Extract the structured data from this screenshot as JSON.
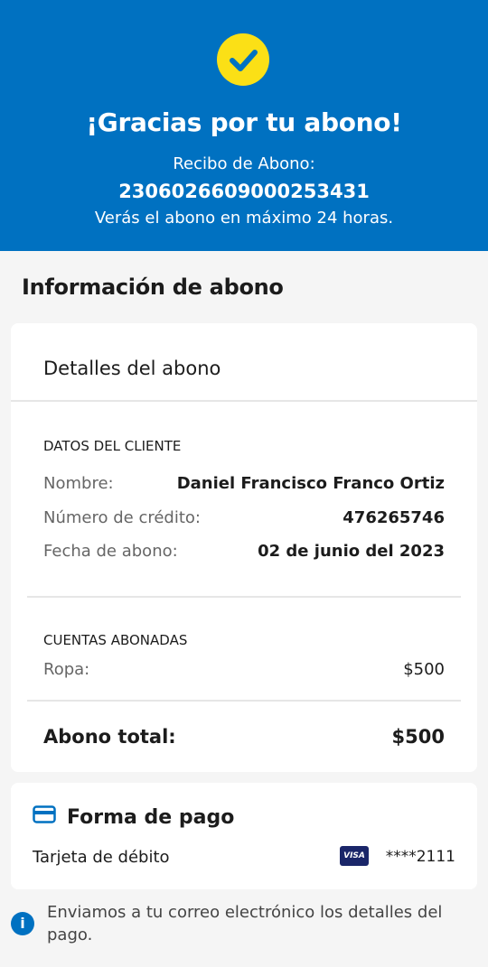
{
  "header": {
    "title": "¡Gracias por tu abono!",
    "receipt_label": "Recibo de Abono:",
    "receipt_number": "2306026609000253431",
    "note": "Verás el abono en máximo 24 horas.",
    "icon": "check-circle-icon",
    "bg_color": "#0071c1",
    "icon_color": "#fbe016"
  },
  "section_title": "Información de abono",
  "details": {
    "title": "Detalles del abono",
    "client": {
      "heading": "DATOS DEL CLIENTE",
      "rows": [
        {
          "label": "Nombre:",
          "value": "Daniel Francisco Franco Ortiz"
        },
        {
          "label": "Número de crédito:",
          "value": "476265746"
        },
        {
          "label": "Fecha de abono:",
          "value": "02 de junio del 2023"
        }
      ]
    },
    "accounts": {
      "heading": "CUENTAS ABONADAS",
      "rows": [
        {
          "label": "Ropa:",
          "value": "$500"
        }
      ]
    },
    "total": {
      "label": "Abono total:",
      "value": "$500"
    }
  },
  "payment": {
    "title": "Forma de pago",
    "icon": "credit-card-icon",
    "method": "Tarjeta de débito",
    "brand": "VISA",
    "card_mask": "****2111"
  },
  "info": {
    "icon": "info-icon",
    "text": "Enviamos a tu correo electrónico los detalles del pago."
  }
}
